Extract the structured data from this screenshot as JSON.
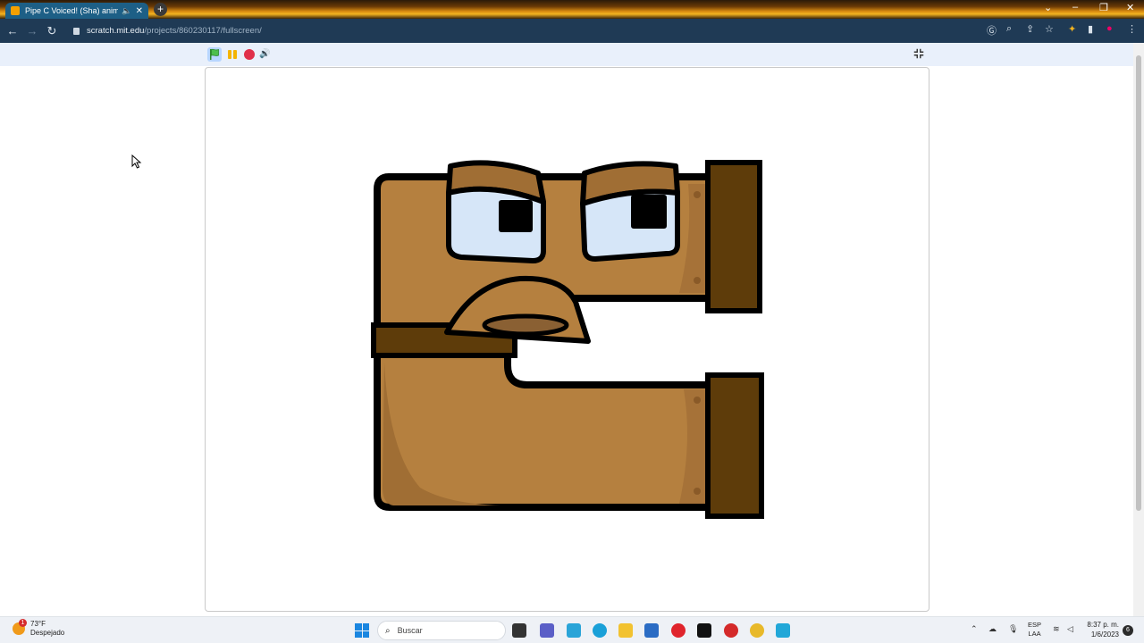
{
  "browser": {
    "tab_title": "Pipe C Voiced! (Sha) animat...",
    "tab_speaker_icon": "speaker-icon",
    "tab_close": "✕",
    "new_tab": "+",
    "url_host": "scratch.mit.edu",
    "url_path": "/projects/860230117/fullscreen/"
  },
  "taskbar": {
    "weather_temp": "73°F",
    "weather_desc": "Despejado",
    "weather_badge": "1",
    "search_placeholder": "Buscar",
    "lang_line1": "ESP",
    "lang_line2": "LAA",
    "clock_time": "8:37 p. m.",
    "clock_date": "1/6/2023",
    "notification_count": "6"
  },
  "colors": {
    "body_fill": "#b5803f",
    "body_shadow": "#a06e34",
    "cap_fill": "#5e3c0a",
    "outline": "#000000",
    "eye_fill": "#d6e6f8",
    "accent_tab": "#1d5f86"
  }
}
